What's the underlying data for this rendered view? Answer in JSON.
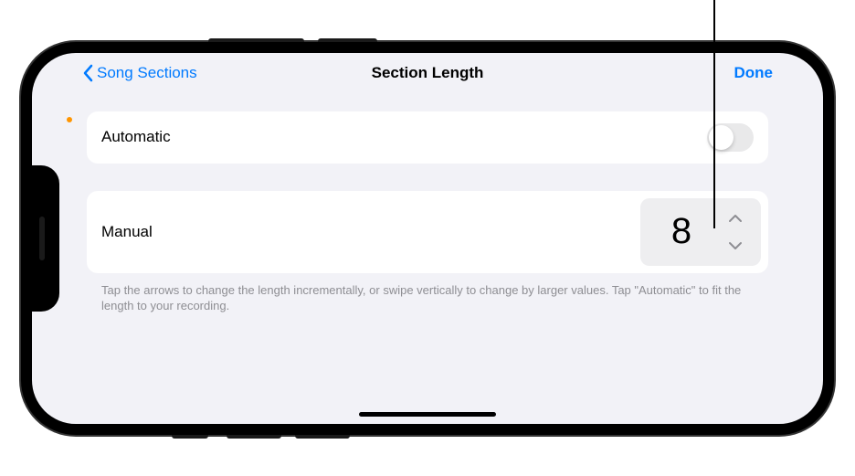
{
  "nav": {
    "back_label": "Song Sections",
    "title": "Section Length",
    "done_label": "Done"
  },
  "automatic": {
    "label": "Automatic",
    "enabled": false
  },
  "manual": {
    "label": "Manual",
    "value": "8"
  },
  "footer": {
    "text": "Tap the arrows to change the length incrementally, or swipe vertically to change by larger values. Tap \"Automatic\" to fit the length to your recording."
  }
}
